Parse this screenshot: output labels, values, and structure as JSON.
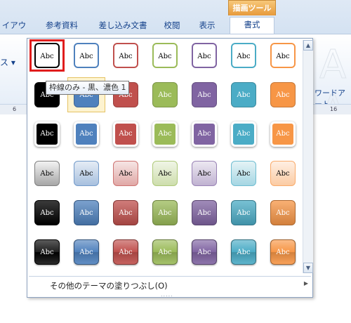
{
  "context_group": "描画ツール",
  "tabs": [
    {
      "label": "イアウト"
    },
    {
      "label": "参考資料"
    },
    {
      "label": "差し込み文書"
    },
    {
      "label": "校閲"
    },
    {
      "label": "表示"
    },
    {
      "label": "書式"
    }
  ],
  "ribbon": {
    "left_fragment": "ス ▾",
    "wordart_label": "ワードアート",
    "wordart_ghost": "A A"
  },
  "ruler": {
    "left_mark": "6",
    "right_mark": "16"
  },
  "tooltip": "枠線のみ - 黒、濃色 1",
  "swatch_text": "Abc",
  "palette": [
    "#000000",
    "#4f81bd",
    "#c0504d",
    "#9bbb59",
    "#8064a2",
    "#4bacc6",
    "#f79646"
  ],
  "rows": [
    {
      "style": "outline"
    },
    {
      "style": "fill"
    },
    {
      "style": "fill-border"
    },
    {
      "style": "light-gradient"
    },
    {
      "style": "gradient"
    },
    {
      "style": "glossy"
    }
  ],
  "footer": {
    "label": "その他のテーマの塗りつぶし(O)",
    "grip": "....."
  }
}
